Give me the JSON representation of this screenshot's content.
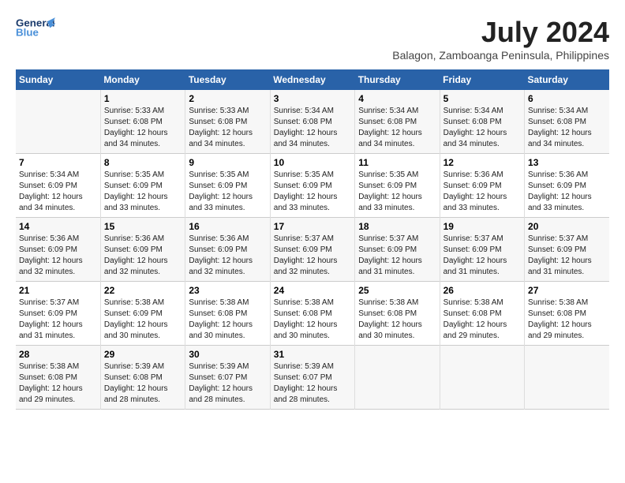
{
  "header": {
    "logo_line1": "General",
    "logo_line2": "Blue",
    "month_year": "July 2024",
    "location": "Balagon, Zamboanga Peninsula, Philippines"
  },
  "days_of_week": [
    "Sunday",
    "Monday",
    "Tuesday",
    "Wednesday",
    "Thursday",
    "Friday",
    "Saturday"
  ],
  "weeks": [
    [
      {
        "day": "",
        "info": ""
      },
      {
        "day": "1",
        "info": "Sunrise: 5:33 AM\nSunset: 6:08 PM\nDaylight: 12 hours\nand 34 minutes."
      },
      {
        "day": "2",
        "info": "Sunrise: 5:33 AM\nSunset: 6:08 PM\nDaylight: 12 hours\nand 34 minutes."
      },
      {
        "day": "3",
        "info": "Sunrise: 5:34 AM\nSunset: 6:08 PM\nDaylight: 12 hours\nand 34 minutes."
      },
      {
        "day": "4",
        "info": "Sunrise: 5:34 AM\nSunset: 6:08 PM\nDaylight: 12 hours\nand 34 minutes."
      },
      {
        "day": "5",
        "info": "Sunrise: 5:34 AM\nSunset: 6:08 PM\nDaylight: 12 hours\nand 34 minutes."
      },
      {
        "day": "6",
        "info": "Sunrise: 5:34 AM\nSunset: 6:08 PM\nDaylight: 12 hours\nand 34 minutes."
      }
    ],
    [
      {
        "day": "7",
        "info": "Sunrise: 5:34 AM\nSunset: 6:09 PM\nDaylight: 12 hours\nand 34 minutes."
      },
      {
        "day": "8",
        "info": "Sunrise: 5:35 AM\nSunset: 6:09 PM\nDaylight: 12 hours\nand 33 minutes."
      },
      {
        "day": "9",
        "info": "Sunrise: 5:35 AM\nSunset: 6:09 PM\nDaylight: 12 hours\nand 33 minutes."
      },
      {
        "day": "10",
        "info": "Sunrise: 5:35 AM\nSunset: 6:09 PM\nDaylight: 12 hours\nand 33 minutes."
      },
      {
        "day": "11",
        "info": "Sunrise: 5:35 AM\nSunset: 6:09 PM\nDaylight: 12 hours\nand 33 minutes."
      },
      {
        "day": "12",
        "info": "Sunrise: 5:36 AM\nSunset: 6:09 PM\nDaylight: 12 hours\nand 33 minutes."
      },
      {
        "day": "13",
        "info": "Sunrise: 5:36 AM\nSunset: 6:09 PM\nDaylight: 12 hours\nand 33 minutes."
      }
    ],
    [
      {
        "day": "14",
        "info": "Sunrise: 5:36 AM\nSunset: 6:09 PM\nDaylight: 12 hours\nand 32 minutes."
      },
      {
        "day": "15",
        "info": "Sunrise: 5:36 AM\nSunset: 6:09 PM\nDaylight: 12 hours\nand 32 minutes."
      },
      {
        "day": "16",
        "info": "Sunrise: 5:36 AM\nSunset: 6:09 PM\nDaylight: 12 hours\nand 32 minutes."
      },
      {
        "day": "17",
        "info": "Sunrise: 5:37 AM\nSunset: 6:09 PM\nDaylight: 12 hours\nand 32 minutes."
      },
      {
        "day": "18",
        "info": "Sunrise: 5:37 AM\nSunset: 6:09 PM\nDaylight: 12 hours\nand 31 minutes."
      },
      {
        "day": "19",
        "info": "Sunrise: 5:37 AM\nSunset: 6:09 PM\nDaylight: 12 hours\nand 31 minutes."
      },
      {
        "day": "20",
        "info": "Sunrise: 5:37 AM\nSunset: 6:09 PM\nDaylight: 12 hours\nand 31 minutes."
      }
    ],
    [
      {
        "day": "21",
        "info": "Sunrise: 5:37 AM\nSunset: 6:09 PM\nDaylight: 12 hours\nand 31 minutes."
      },
      {
        "day": "22",
        "info": "Sunrise: 5:38 AM\nSunset: 6:09 PM\nDaylight: 12 hours\nand 30 minutes."
      },
      {
        "day": "23",
        "info": "Sunrise: 5:38 AM\nSunset: 6:08 PM\nDaylight: 12 hours\nand 30 minutes."
      },
      {
        "day": "24",
        "info": "Sunrise: 5:38 AM\nSunset: 6:08 PM\nDaylight: 12 hours\nand 30 minutes."
      },
      {
        "day": "25",
        "info": "Sunrise: 5:38 AM\nSunset: 6:08 PM\nDaylight: 12 hours\nand 30 minutes."
      },
      {
        "day": "26",
        "info": "Sunrise: 5:38 AM\nSunset: 6:08 PM\nDaylight: 12 hours\nand 29 minutes."
      },
      {
        "day": "27",
        "info": "Sunrise: 5:38 AM\nSunset: 6:08 PM\nDaylight: 12 hours\nand 29 minutes."
      }
    ],
    [
      {
        "day": "28",
        "info": "Sunrise: 5:38 AM\nSunset: 6:08 PM\nDaylight: 12 hours\nand 29 minutes."
      },
      {
        "day": "29",
        "info": "Sunrise: 5:39 AM\nSunset: 6:08 PM\nDaylight: 12 hours\nand 28 minutes."
      },
      {
        "day": "30",
        "info": "Sunrise: 5:39 AM\nSunset: 6:07 PM\nDaylight: 12 hours\nand 28 minutes."
      },
      {
        "day": "31",
        "info": "Sunrise: 5:39 AM\nSunset: 6:07 PM\nDaylight: 12 hours\nand 28 minutes."
      },
      {
        "day": "",
        "info": ""
      },
      {
        "day": "",
        "info": ""
      },
      {
        "day": "",
        "info": ""
      }
    ]
  ]
}
